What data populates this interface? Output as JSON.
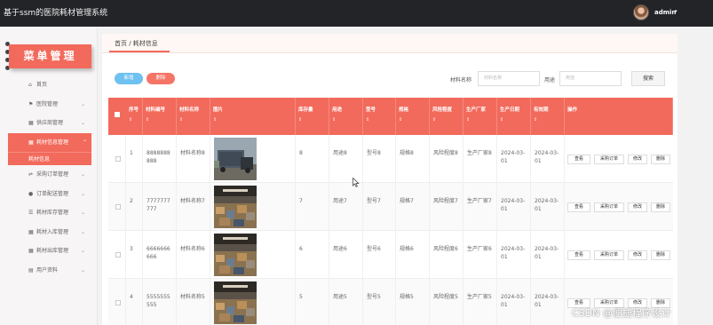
{
  "app": {
    "title": "基于ssm的医院耗材管理系统",
    "user": "admin",
    "user_caret": "▾"
  },
  "logo": {
    "text": "菜单管理"
  },
  "sidebar": {
    "items": [
      {
        "icon": "home-icon",
        "glyph": "⌂",
        "label": "首页",
        "chevron": ""
      },
      {
        "icon": "flag-icon",
        "glyph": "⚑",
        "label": "医院管理",
        "chevron": "⌄"
      },
      {
        "icon": "grid-icon",
        "glyph": "▦",
        "label": "供应商管理",
        "chevron": "⌄"
      },
      {
        "icon": "grid-icon",
        "glyph": "▦",
        "label": "耗材信息管理",
        "chevron": "⌃",
        "active": true
      },
      {
        "icon": "sliders-icon",
        "glyph": "⇌",
        "label": "采购订单管理",
        "chevron": "⌄"
      },
      {
        "icon": "pin-icon",
        "glyph": "●",
        "label": "订单配送管理",
        "chevron": "⌄"
      },
      {
        "icon": "list-icon",
        "glyph": "☰",
        "label": "耗材库存管理",
        "chevron": "⌄"
      },
      {
        "icon": "grid-icon",
        "glyph": "▦",
        "label": "耗材入库管理",
        "chevron": "⌄"
      },
      {
        "icon": "grid-icon",
        "glyph": "▦",
        "label": "耗材出库管理",
        "chevron": "⌄"
      },
      {
        "icon": "calendar-icon",
        "glyph": "▤",
        "label": "用户资料",
        "chevron": "⌄"
      }
    ],
    "sub_item": "耗材信息"
  },
  "breadcrumb": "首页 / 耗材信息",
  "toolbar": {
    "add_label": "新增",
    "delete_label": "删除",
    "name_label": "材料名称",
    "name_placeholder": "材料名称",
    "use_label": "用途",
    "use_placeholder": "用途",
    "search_label": "搜索"
  },
  "table": {
    "sort_glyph": "⇕",
    "headers": [
      "序号",
      "材料编号",
      "材料名称",
      "图片",
      "库存量",
      "用途",
      "型号",
      "规格",
      "风险程度",
      "生产厂家",
      "生产日期",
      "有效期",
      "操作"
    ],
    "rows": [
      {
        "idx": "1",
        "code": "8888888888",
        "name": "材料名称8",
        "stock": "8",
        "use": "用途8",
        "model": "型号8",
        "spec": "规格8",
        "risk": "风险程度8",
        "maker": "生产厂家8",
        "prod_date": "2024-03-01",
        "expiry": "2024-03-01"
      },
      {
        "idx": "2",
        "code": "7777777777",
        "name": "材料名称7",
        "stock": "7",
        "use": "用途7",
        "model": "型号7",
        "spec": "规格7",
        "risk": "风险程度7",
        "maker": "生产厂家7",
        "prod_date": "2024-03-01",
        "expiry": "2024-03-01"
      },
      {
        "idx": "3",
        "code": "6666666666",
        "name": "材料名称6",
        "stock": "6",
        "use": "用途6",
        "model": "型号6",
        "spec": "规格6",
        "risk": "风险程度6",
        "maker": "生产厂家6",
        "prod_date": "2024-03-01",
        "expiry": "2024-03-01"
      },
      {
        "idx": "4",
        "code": "5555555555",
        "name": "材料名称5",
        "stock": "5",
        "use": "用途5",
        "model": "型号5",
        "spec": "规格5",
        "risk": "风险程度5",
        "maker": "生产厂家5",
        "prod_date": "2024-03-01",
        "expiry": "2024-03-01"
      }
    ],
    "actions": [
      "查看",
      "采购订单",
      "修改",
      "删除"
    ]
  },
  "watermark": "CSDN @便捷程序设计",
  "colors": {
    "accent": "#f26a5c",
    "topbar": "#222428",
    "add_button": "#6ec1f1"
  }
}
